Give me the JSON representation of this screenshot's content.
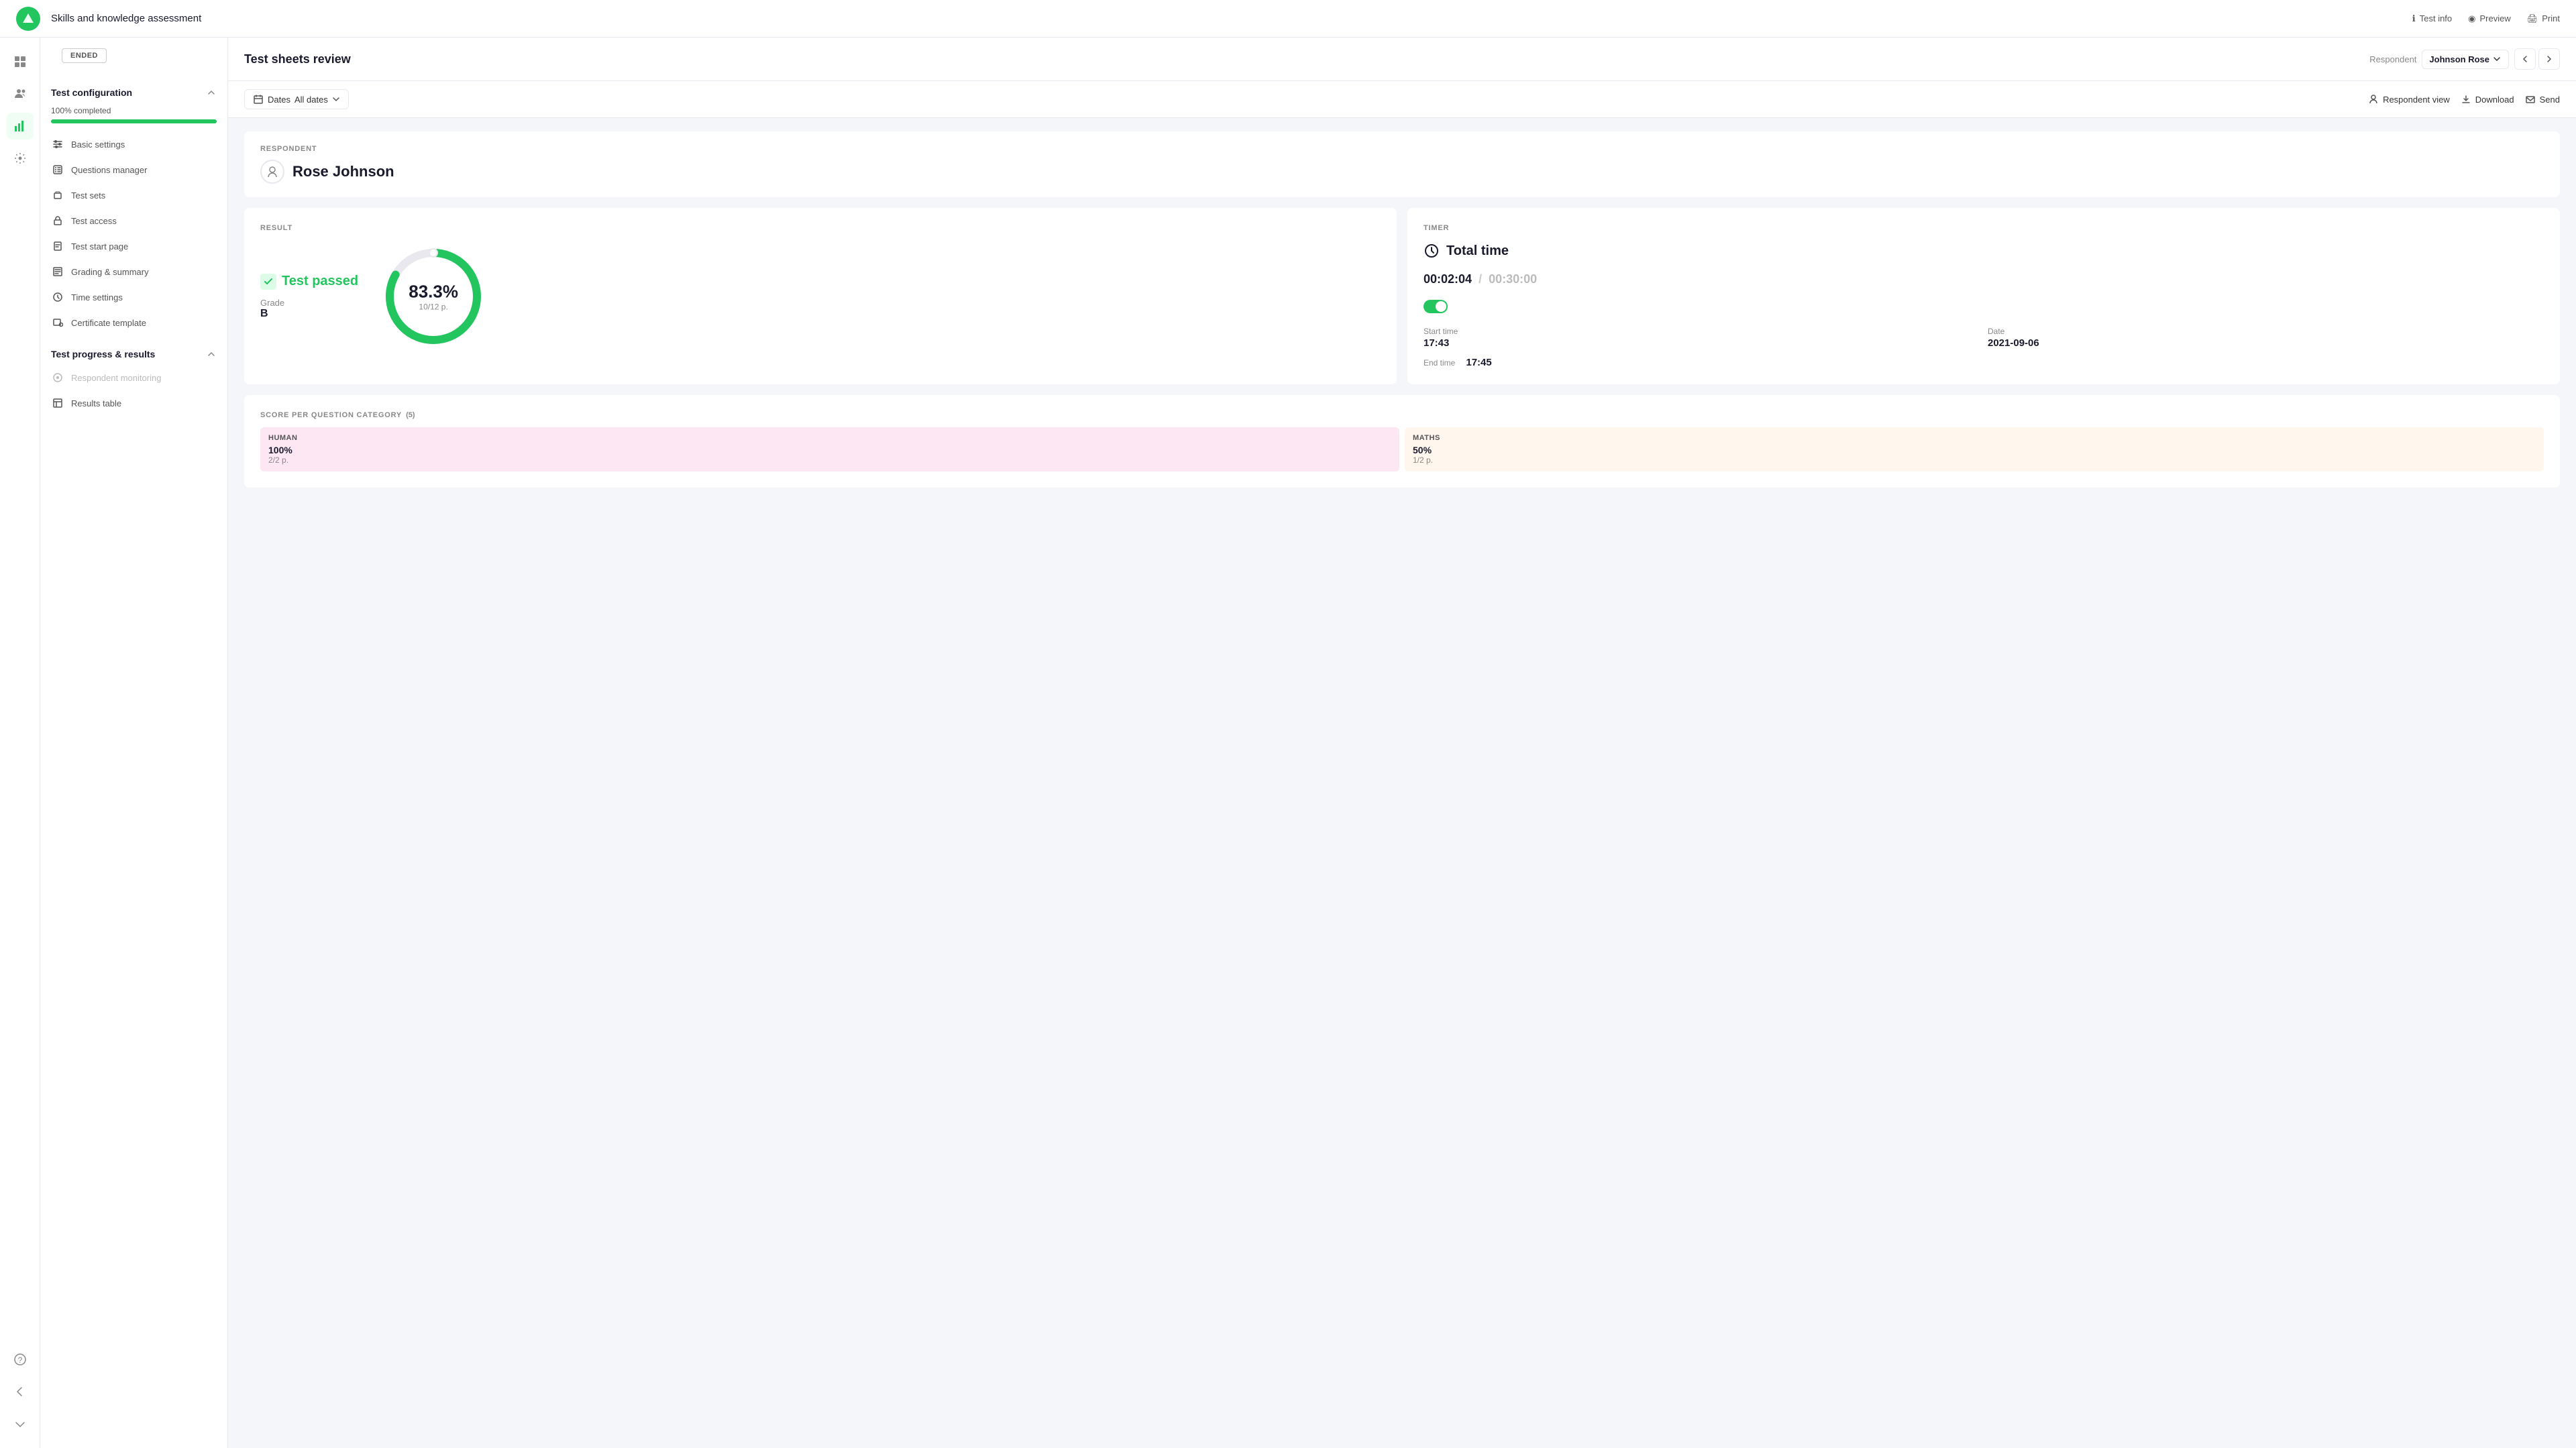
{
  "header": {
    "title": "Skills and knowledge assessment",
    "actions": [
      {
        "key": "test-info",
        "label": "Test info",
        "icon": "info-icon"
      },
      {
        "key": "preview",
        "label": "Preview",
        "icon": "preview-icon"
      },
      {
        "key": "print",
        "label": "Print",
        "icon": "print-icon"
      }
    ]
  },
  "iconbar": {
    "items": [
      {
        "key": "dashboard",
        "icon": "grid-icon",
        "active": false
      },
      {
        "key": "users",
        "icon": "users-icon",
        "active": false
      },
      {
        "key": "results",
        "icon": "chart-icon",
        "active": true
      },
      {
        "key": "settings",
        "icon": "settings-icon",
        "active": false
      }
    ],
    "bottom": [
      {
        "key": "help",
        "icon": "help-icon"
      },
      {
        "key": "back",
        "icon": "back-icon"
      },
      {
        "key": "collapse",
        "icon": "collapse-icon"
      }
    ]
  },
  "sidebar": {
    "status": "ENDED",
    "sections": [
      {
        "key": "test-configuration",
        "title": "Test configuration",
        "progress_label": "100% completed",
        "progress_value": 100,
        "items": [
          {
            "key": "basic-settings",
            "label": "Basic settings",
            "icon": "sliders-icon",
            "active": false
          },
          {
            "key": "questions-manager",
            "label": "Questions manager",
            "icon": "questions-icon",
            "active": false
          },
          {
            "key": "test-sets",
            "label": "Test sets",
            "icon": "sets-icon",
            "active": false
          },
          {
            "key": "test-access",
            "label": "Test access",
            "icon": "lock-icon",
            "active": false
          },
          {
            "key": "test-start-page",
            "label": "Test start page",
            "icon": "page-icon",
            "active": false
          },
          {
            "key": "grading-summary",
            "label": "Grading & summary",
            "icon": "grade-icon",
            "active": false
          },
          {
            "key": "time-settings",
            "label": "Time settings",
            "icon": "clock-icon",
            "active": false
          },
          {
            "key": "certificate-template",
            "label": "Certificate template",
            "icon": "cert-icon",
            "active": false
          }
        ]
      },
      {
        "key": "test-progress",
        "title": "Test progress & results",
        "items": [
          {
            "key": "respondent-monitoring",
            "label": "Respondent monitoring",
            "icon": "monitor-icon",
            "active": false
          },
          {
            "key": "results-table",
            "label": "Results table",
            "icon": "table-icon",
            "active": false
          }
        ]
      }
    ]
  },
  "content_header": {
    "title": "Test sheets review",
    "respondent_label": "Respondent",
    "respondent_name": "Johnson Rose"
  },
  "toolbar": {
    "dates_label": "Dates",
    "dates_value": "All dates",
    "respondent_view_label": "Respondent view",
    "download_label": "Download",
    "send_label": "Send"
  },
  "respondent_section": {
    "label": "RESPONDENT",
    "name": "Rose Johnson"
  },
  "result_section": {
    "label": "RESULT",
    "status": "Test passed",
    "grade_label": "Grade",
    "grade": "B",
    "percent": "83.3%",
    "score": "10/12 p.",
    "donut_filled": 83.3
  },
  "timer_section": {
    "label": "TIMER",
    "total_time_label": "Total time",
    "time_actual": "00:02:04",
    "time_separator": "/",
    "time_total": "00:30:00",
    "start_time_label": "Start time",
    "start_time": "17:43",
    "date_label": "Date",
    "date": "2021-09-06",
    "end_time_label": "End time",
    "end_time": "17:45"
  },
  "score_section": {
    "label": "SCORE PER QUESTION CATEGORY",
    "count": "(5)",
    "categories": [
      {
        "key": "human",
        "name": "HUMAN",
        "percent": "100%",
        "score": "2/2 p.",
        "color": "cat-pink"
      },
      {
        "key": "maths",
        "name": "MATHS",
        "percent": "50%",
        "score": "1/2 p.",
        "color": "cat-orange"
      }
    ]
  }
}
